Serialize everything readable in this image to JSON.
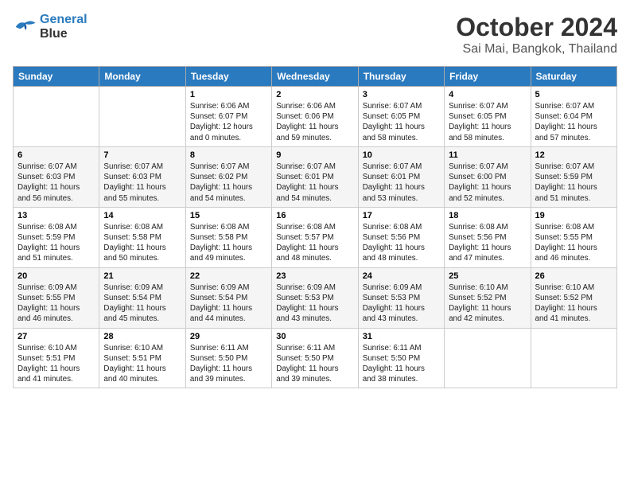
{
  "header": {
    "logo_line1": "General",
    "logo_line2": "Blue",
    "title": "October 2024",
    "subtitle": "Sai Mai, Bangkok, Thailand"
  },
  "calendar": {
    "days_of_week": [
      "Sunday",
      "Monday",
      "Tuesday",
      "Wednesday",
      "Thursday",
      "Friday",
      "Saturday"
    ],
    "weeks": [
      [
        {
          "day": "",
          "info": ""
        },
        {
          "day": "",
          "info": ""
        },
        {
          "day": "1",
          "info": "Sunrise: 6:06 AM\nSunset: 6:07 PM\nDaylight: 12 hours\nand 0 minutes."
        },
        {
          "day": "2",
          "info": "Sunrise: 6:06 AM\nSunset: 6:06 PM\nDaylight: 11 hours\nand 59 minutes."
        },
        {
          "day": "3",
          "info": "Sunrise: 6:07 AM\nSunset: 6:05 PM\nDaylight: 11 hours\nand 58 minutes."
        },
        {
          "day": "4",
          "info": "Sunrise: 6:07 AM\nSunset: 6:05 PM\nDaylight: 11 hours\nand 58 minutes."
        },
        {
          "day": "5",
          "info": "Sunrise: 6:07 AM\nSunset: 6:04 PM\nDaylight: 11 hours\nand 57 minutes."
        }
      ],
      [
        {
          "day": "6",
          "info": "Sunrise: 6:07 AM\nSunset: 6:03 PM\nDaylight: 11 hours\nand 56 minutes."
        },
        {
          "day": "7",
          "info": "Sunrise: 6:07 AM\nSunset: 6:03 PM\nDaylight: 11 hours\nand 55 minutes."
        },
        {
          "day": "8",
          "info": "Sunrise: 6:07 AM\nSunset: 6:02 PM\nDaylight: 11 hours\nand 54 minutes."
        },
        {
          "day": "9",
          "info": "Sunrise: 6:07 AM\nSunset: 6:01 PM\nDaylight: 11 hours\nand 54 minutes."
        },
        {
          "day": "10",
          "info": "Sunrise: 6:07 AM\nSunset: 6:01 PM\nDaylight: 11 hours\nand 53 minutes."
        },
        {
          "day": "11",
          "info": "Sunrise: 6:07 AM\nSunset: 6:00 PM\nDaylight: 11 hours\nand 52 minutes."
        },
        {
          "day": "12",
          "info": "Sunrise: 6:07 AM\nSunset: 5:59 PM\nDaylight: 11 hours\nand 51 minutes."
        }
      ],
      [
        {
          "day": "13",
          "info": "Sunrise: 6:08 AM\nSunset: 5:59 PM\nDaylight: 11 hours\nand 51 minutes."
        },
        {
          "day": "14",
          "info": "Sunrise: 6:08 AM\nSunset: 5:58 PM\nDaylight: 11 hours\nand 50 minutes."
        },
        {
          "day": "15",
          "info": "Sunrise: 6:08 AM\nSunset: 5:58 PM\nDaylight: 11 hours\nand 49 minutes."
        },
        {
          "day": "16",
          "info": "Sunrise: 6:08 AM\nSunset: 5:57 PM\nDaylight: 11 hours\nand 48 minutes."
        },
        {
          "day": "17",
          "info": "Sunrise: 6:08 AM\nSunset: 5:56 PM\nDaylight: 11 hours\nand 48 minutes."
        },
        {
          "day": "18",
          "info": "Sunrise: 6:08 AM\nSunset: 5:56 PM\nDaylight: 11 hours\nand 47 minutes."
        },
        {
          "day": "19",
          "info": "Sunrise: 6:08 AM\nSunset: 5:55 PM\nDaylight: 11 hours\nand 46 minutes."
        }
      ],
      [
        {
          "day": "20",
          "info": "Sunrise: 6:09 AM\nSunset: 5:55 PM\nDaylight: 11 hours\nand 46 minutes."
        },
        {
          "day": "21",
          "info": "Sunrise: 6:09 AM\nSunset: 5:54 PM\nDaylight: 11 hours\nand 45 minutes."
        },
        {
          "day": "22",
          "info": "Sunrise: 6:09 AM\nSunset: 5:54 PM\nDaylight: 11 hours\nand 44 minutes."
        },
        {
          "day": "23",
          "info": "Sunrise: 6:09 AM\nSunset: 5:53 PM\nDaylight: 11 hours\nand 43 minutes."
        },
        {
          "day": "24",
          "info": "Sunrise: 6:09 AM\nSunset: 5:53 PM\nDaylight: 11 hours\nand 43 minutes."
        },
        {
          "day": "25",
          "info": "Sunrise: 6:10 AM\nSunset: 5:52 PM\nDaylight: 11 hours\nand 42 minutes."
        },
        {
          "day": "26",
          "info": "Sunrise: 6:10 AM\nSunset: 5:52 PM\nDaylight: 11 hours\nand 41 minutes."
        }
      ],
      [
        {
          "day": "27",
          "info": "Sunrise: 6:10 AM\nSunset: 5:51 PM\nDaylight: 11 hours\nand 41 minutes."
        },
        {
          "day": "28",
          "info": "Sunrise: 6:10 AM\nSunset: 5:51 PM\nDaylight: 11 hours\nand 40 minutes."
        },
        {
          "day": "29",
          "info": "Sunrise: 6:11 AM\nSunset: 5:50 PM\nDaylight: 11 hours\nand 39 minutes."
        },
        {
          "day": "30",
          "info": "Sunrise: 6:11 AM\nSunset: 5:50 PM\nDaylight: 11 hours\nand 39 minutes."
        },
        {
          "day": "31",
          "info": "Sunrise: 6:11 AM\nSunset: 5:50 PM\nDaylight: 11 hours\nand 38 minutes."
        },
        {
          "day": "",
          "info": ""
        },
        {
          "day": "",
          "info": ""
        }
      ]
    ]
  }
}
